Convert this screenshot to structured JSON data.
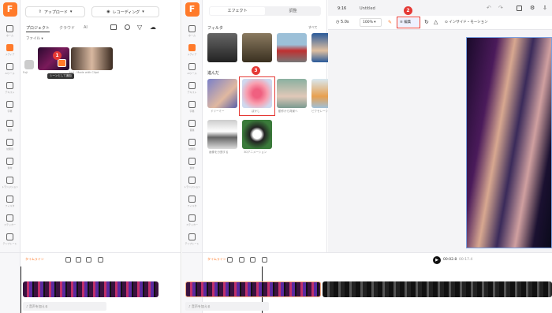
{
  "left_panel": {
    "rail_labels": [
      "ホーム",
      "メディア",
      "AIツール",
      "テキスト",
      "字幕",
      "音楽",
      "効果音",
      "素材",
      "トランジション",
      "フィルタ",
      "ステッカー",
      "テンプレート"
    ],
    "import_label": "アップロード",
    "record_label": "レコーディング",
    "tabs": [
      "プロジェクト",
      "クラウド",
      "AI"
    ],
    "folder_label": "ファイル",
    "media_caption": "ted - Made with Clipd",
    "media_caption2": "Fuji",
    "tooltip": "シーンとして追加",
    "add_audio": "音声を加える",
    "timeline_label": "タイムライン"
  },
  "right_panel": {
    "tabs": [
      "エフェクト",
      "調整"
    ],
    "filter_title": "フィルタ",
    "see_all": "すべて",
    "advanced_title": "進んだ",
    "effects": [
      {
        "name": "ドリーミー"
      },
      {
        "name": "ぼかし"
      },
      {
        "name": "動作から背景へ"
      },
      {
        "name": "ピクセレーション"
      },
      {
        "name": "画像を分割する"
      },
      {
        "name": "3Dアニメーション"
      }
    ],
    "toolbar": {
      "ratio": "9:16",
      "title": "Untitled",
      "duration": "5.0s",
      "zoom": "100%",
      "edit_label": "編集",
      "motion_label": "インサイド・モーション"
    },
    "time": "00:02.8",
    "time_total": "00:17.4",
    "timeline_label": "タイムライン",
    "add_audio": "音声を加える"
  },
  "annotations": [
    "1",
    "2",
    "3"
  ]
}
